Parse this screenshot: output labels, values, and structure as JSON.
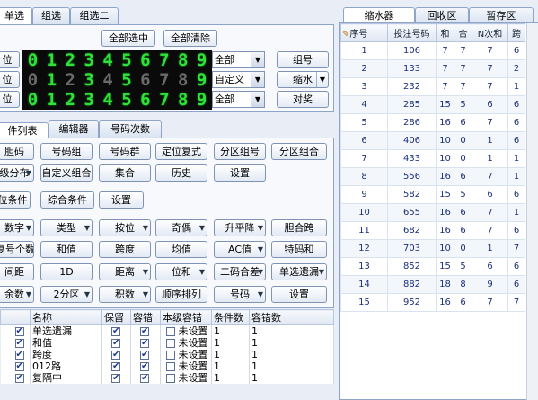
{
  "left_tabs": [
    "单选",
    "组选",
    "组选二"
  ],
  "top_buttons": {
    "select_all": "全部选中",
    "clear_all": "全部清除"
  },
  "digit_rows": [
    {
      "label": "位",
      "digits": [
        "0",
        "1",
        "2",
        "3",
        "4",
        "5",
        "6",
        "7",
        "8",
        "9"
      ],
      "dim": [
        false,
        false,
        false,
        false,
        false,
        false,
        false,
        false,
        false,
        false
      ],
      "combo": "全部"
    },
    {
      "label": "位",
      "digits": [
        "0",
        "1",
        "2",
        "3",
        "4",
        "5",
        "6",
        "7",
        "8",
        "9"
      ],
      "dim": [
        true,
        false,
        true,
        false,
        true,
        false,
        true,
        true,
        true,
        false
      ],
      "combo": "自定义"
    },
    {
      "label": "位",
      "digits": [
        "0",
        "1",
        "2",
        "3",
        "4",
        "5",
        "6",
        "7",
        "8",
        "9"
      ],
      "dim": [
        false,
        false,
        false,
        false,
        false,
        false,
        false,
        false,
        false,
        false
      ],
      "combo": "全部"
    }
  ],
  "side_buttons": {
    "group": "组号",
    "shrink": "缩水",
    "award": "对奖"
  },
  "mid_tabs": [
    "件列表",
    "编辑器",
    "号码次数"
  ],
  "button_rows": [
    [
      {
        "t": "胆码",
        "d": false
      },
      {
        "t": "号码组",
        "d": false
      },
      {
        "t": "号码群",
        "d": false
      },
      {
        "t": "定位复式",
        "d": false
      },
      {
        "t": "分区组号",
        "d": false
      },
      {
        "t": "分区组合",
        "d": false
      }
    ],
    [
      {
        "t": "级分布",
        "d": true
      },
      {
        "t": "自定义组合",
        "d": false
      },
      {
        "t": "集合",
        "d": false
      },
      {
        "t": "历史",
        "d": false
      },
      {
        "t": "设置",
        "d": false
      }
    ],
    [
      {
        "t": "位条件",
        "d": false
      },
      {
        "t": "综合条件",
        "d": false
      },
      {
        "t": "设置",
        "d": false
      }
    ],
    [
      {
        "t": "数字",
        "d": true
      },
      {
        "t": "类型",
        "d": true
      },
      {
        "t": "按位",
        "d": true
      },
      {
        "t": "奇偶",
        "d": true
      },
      {
        "t": "升平降",
        "d": true
      },
      {
        "t": "胆合跨",
        "d": false
      }
    ],
    [
      {
        "t": "复号个数",
        "d": false
      },
      {
        "t": "和值",
        "d": false
      },
      {
        "t": "跨度",
        "d": false
      },
      {
        "t": "均值",
        "d": false
      },
      {
        "t": "AC值",
        "d": true
      },
      {
        "t": "特码和",
        "d": false
      }
    ],
    [
      {
        "t": "间距",
        "d": false
      },
      {
        "t": "1D",
        "d": false
      },
      {
        "t": "距离",
        "d": true
      },
      {
        "t": "位和",
        "d": true
      },
      {
        "t": "二码合差",
        "d": true
      },
      {
        "t": "单选遗漏",
        "d": true
      }
    ],
    [
      {
        "t": "余数",
        "d": true
      },
      {
        "t": "2分区",
        "d": true
      },
      {
        "t": "积数",
        "d": true
      },
      {
        "t": "顺序排列",
        "d": false
      },
      {
        "t": "号码",
        "d": true
      },
      {
        "t": "设置",
        "d": false
      }
    ]
  ],
  "cond_table": {
    "headers": [
      "名称",
      "保留",
      "容错",
      "本级容错",
      "条件数",
      "容错数"
    ],
    "rows": [
      {
        "name": "单选遗漏",
        "tol": "未设置",
        "n": "1",
        "e": "1"
      },
      {
        "name": "和值",
        "tol": "未设置",
        "n": "1",
        "e": "1"
      },
      {
        "name": "跨度",
        "tol": "未设置",
        "n": "1",
        "e": "1"
      },
      {
        "name": "012路",
        "tol": "未设置",
        "n": "1",
        "e": "1"
      },
      {
        "name": "复隔中",
        "tol": "未设置",
        "n": "1",
        "e": "1"
      }
    ]
  },
  "right_tabs": [
    "缩水器",
    "回收区",
    "暂存区"
  ],
  "result_table": {
    "headers": [
      "序号",
      "投注号码",
      "和",
      "合",
      "N次和",
      "跨"
    ],
    "rows": [
      [
        "1",
        "106",
        "7",
        "7",
        "7",
        "6"
      ],
      [
        "2",
        "133",
        "7",
        "7",
        "7",
        "2"
      ],
      [
        "3",
        "232",
        "7",
        "7",
        "7",
        "1"
      ],
      [
        "4",
        "285",
        "15",
        "5",
        "6",
        "6"
      ],
      [
        "5",
        "286",
        "16",
        "6",
        "7",
        "6"
      ],
      [
        "6",
        "406",
        "10",
        "0",
        "1",
        "6"
      ],
      [
        "7",
        "433",
        "10",
        "0",
        "1",
        "1"
      ],
      [
        "8",
        "556",
        "16",
        "6",
        "7",
        "1"
      ],
      [
        "9",
        "582",
        "15",
        "5",
        "6",
        "6"
      ],
      [
        "10",
        "655",
        "16",
        "6",
        "7",
        "1"
      ],
      [
        "11",
        "682",
        "16",
        "6",
        "7",
        "6"
      ],
      [
        "12",
        "703",
        "10",
        "0",
        "1",
        "7"
      ],
      [
        "13",
        "852",
        "15",
        "5",
        "6",
        "6"
      ],
      [
        "14",
        "882",
        "18",
        "8",
        "9",
        "6"
      ],
      [
        "15",
        "952",
        "16",
        "6",
        "7",
        "7"
      ]
    ]
  }
}
